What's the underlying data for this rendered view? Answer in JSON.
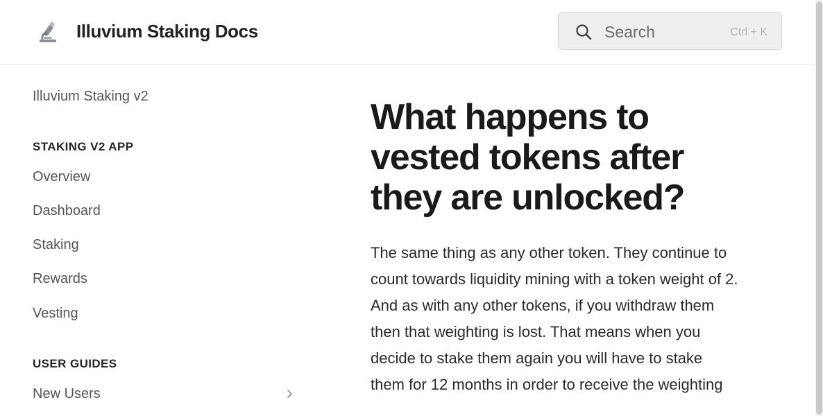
{
  "header": {
    "site_title": "Illuvium Staking Docs",
    "logo_icon": "microscope-icon",
    "search": {
      "placeholder": "Search",
      "shortcut": "Ctrl + K",
      "icon": "search-icon"
    }
  },
  "sidebar": {
    "top_link": "Illuvium Staking v2",
    "sections": [
      {
        "heading": "STAKING V2 APP",
        "items": [
          {
            "label": "Overview"
          },
          {
            "label": "Dashboard"
          },
          {
            "label": "Staking"
          },
          {
            "label": "Rewards"
          },
          {
            "label": "Vesting"
          }
        ]
      },
      {
        "heading": "USER GUIDES",
        "items": [
          {
            "label": "New Users",
            "icon": "chevron-right-icon"
          }
        ]
      }
    ]
  },
  "main": {
    "title": "What happens to vested tokens after they are unlocked?",
    "paragraph": "The same thing as any other token. They continue to count towards liquidity mining with a token weight of 2. And as with any other tokens, if you withdraw them then that weighting is lost. That means when you decide to stake them again you will have to stake them for 12 months in order to receive the weighting"
  },
  "colors": {
    "text_primary": "#1a1a1a",
    "text_muted": "#555555",
    "search_bg": "#efefef",
    "border": "#ececec"
  }
}
